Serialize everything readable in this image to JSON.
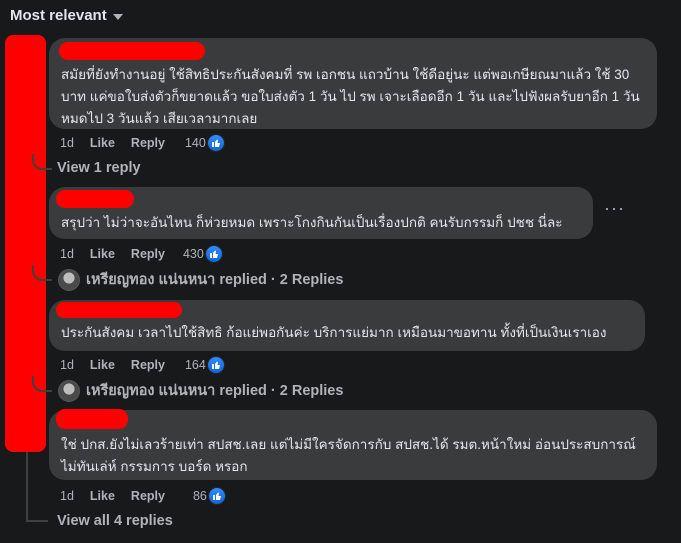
{
  "header": {
    "sort_label": "Most relevant"
  },
  "comments": [
    {
      "text": "สมัยที่ยังทำงานอยู่ ใช้สิทธิประกันสังคมที่ รพ เอกชน แถวบ้าน ใช้ดีอยู่นะ แต่พอเกษียณมาแล้ว ใช้ 30 บาท แค่ขอใบส่งตัวก็ขยาดแล้ว ขอใบส่งตัว 1 วัน ไป รพ เจาะเลือดอีก 1 วัน และไปฟังผลรับยาอีก 1 วัน หมดไป 3 วันแล้ว เสียเวลามากเลย",
      "time": "1d",
      "like": "Like",
      "reply": "Reply",
      "reactions": "140",
      "footer_link": "View 1 reply"
    },
    {
      "text": "สรุปว่า ไม่ว่าจะอันไหน ก็ห่วยหมด เพราะโกงกินกันเป็นเรื่องปกติ คนรับกรรมก็ ปชช นี่ละ",
      "time": "1d",
      "like": "Like",
      "reply": "Reply",
      "reactions": "430",
      "footer_link": "เหรียญทอง แน่นหนา replied · 2 Replies",
      "more": "···"
    },
    {
      "text": "ประกันสังคม เวลาไปใช้สิทธิ ก้อแย่พอกันค่ะ บริการแย่มาก เหมือนมาขอทาน ทั้งที่เป็นเงินเราเอง",
      "time": "1d",
      "like": "Like",
      "reply": "Reply",
      "reactions": "164",
      "footer_link": "เหรียญทอง แน่นหนา replied · 2 Replies"
    },
    {
      "text": "ใช่ ปกส.ยังไม่เลวร้ายเท่า สปสช.เลย แต่ไม่มีใครจัดการกับ สปสช.ได้ รมต.หน้าใหม่ อ่อนประสบการณ์ ไม่ทันเล่ห์ กรรมการ บอร์ด หรอก",
      "time": "1d",
      "like": "Like",
      "reply": "Reply",
      "reactions": "86"
    }
  ],
  "view_all": "View all 4 replies",
  "colors": {
    "background": "#18191a",
    "bubble": "#3a3b3c",
    "redaction": "#ff0000",
    "like_blue": "#2374e1"
  },
  "icons": {
    "sort": "chevron-down-icon",
    "reaction": "like-thumb-icon",
    "replier_avatar": "avatar-icon"
  }
}
